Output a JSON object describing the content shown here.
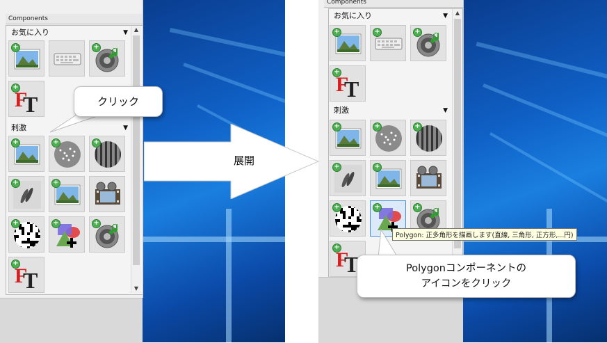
{
  "left_panel": {
    "header": "Components",
    "categories": [
      {
        "label": "お気に入り",
        "arrow": "▼"
      },
      {
        "label": "刺激",
        "arrow": "▼"
      }
    ]
  },
  "right_panel": {
    "header": "Components",
    "categories": [
      {
        "label": "お気に入り",
        "arrow": "▼"
      },
      {
        "label": "刺激",
        "arrow": "▼"
      }
    ]
  },
  "scroll": {
    "up": "▲",
    "down": "▼"
  },
  "icons": {
    "image": "landscape-image-icon",
    "keyboard": "keyboard-icon",
    "sound": "speaker-music-icon",
    "text": "text-ft-icon",
    "dots": "moving-dots-icon",
    "grating": "grating-icon",
    "gabor": "gabor-icon",
    "movie": "film-reel-icon",
    "noise": "noise-icon",
    "polygon": "polygon-icon"
  },
  "callouts": {
    "click": "クリック",
    "expand": "展開",
    "polygon_line1": "Polygonコンポーネントの",
    "polygon_line2": "アイコンをクリック"
  },
  "tooltip": "Polygon: 正多角形を描画します(直線, 三角形, 正方形,...円)",
  "colors": {
    "accent_blue": "#4a90d9",
    "plus_green": "#4caf50",
    "desktop_blue": "#0f5fc4"
  }
}
